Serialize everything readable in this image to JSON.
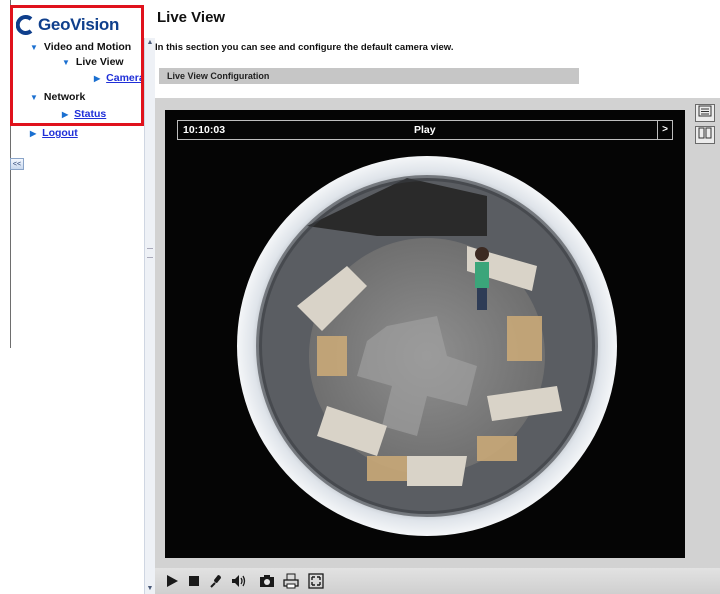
{
  "sidebar": {
    "logo_text": "GeoVision",
    "items": [
      {
        "label": "Video and Motion",
        "level": 0,
        "expanded": true,
        "link": false
      },
      {
        "label": "Live View",
        "level": 1,
        "expanded": true,
        "link": false
      },
      {
        "label": "Camera",
        "level": 2,
        "expanded": false,
        "link": true
      },
      {
        "label": "Network",
        "level": 0,
        "expanded": true,
        "link": false
      },
      {
        "label": "Status",
        "level": 1,
        "expanded": false,
        "link": true
      },
      {
        "label": "Logout",
        "level": 0,
        "expanded": false,
        "link": true
      }
    ],
    "collapse_label": "<<"
  },
  "main": {
    "title": "Live View",
    "description": "In this section you can see and configure the default camera view.",
    "section_header": "Live View Configuration",
    "video": {
      "timestamp": "10:10:03",
      "status": "Play",
      "next_symbol": ">"
    },
    "toolbar": {
      "icons": [
        "play-icon",
        "stop-icon",
        "microphone-icon",
        "speaker-icon",
        "snapshot-icon",
        "print-icon",
        "fullscreen-icon"
      ]
    },
    "side_buttons": [
      "settings-panel-icon",
      "io-control-icon"
    ]
  },
  "colors": {
    "highlight": "#e0121c",
    "logo": "#0f3f8c",
    "link": "#1f2fd8",
    "section_bar": "#c6c6c6",
    "video_bg": "#050505"
  }
}
